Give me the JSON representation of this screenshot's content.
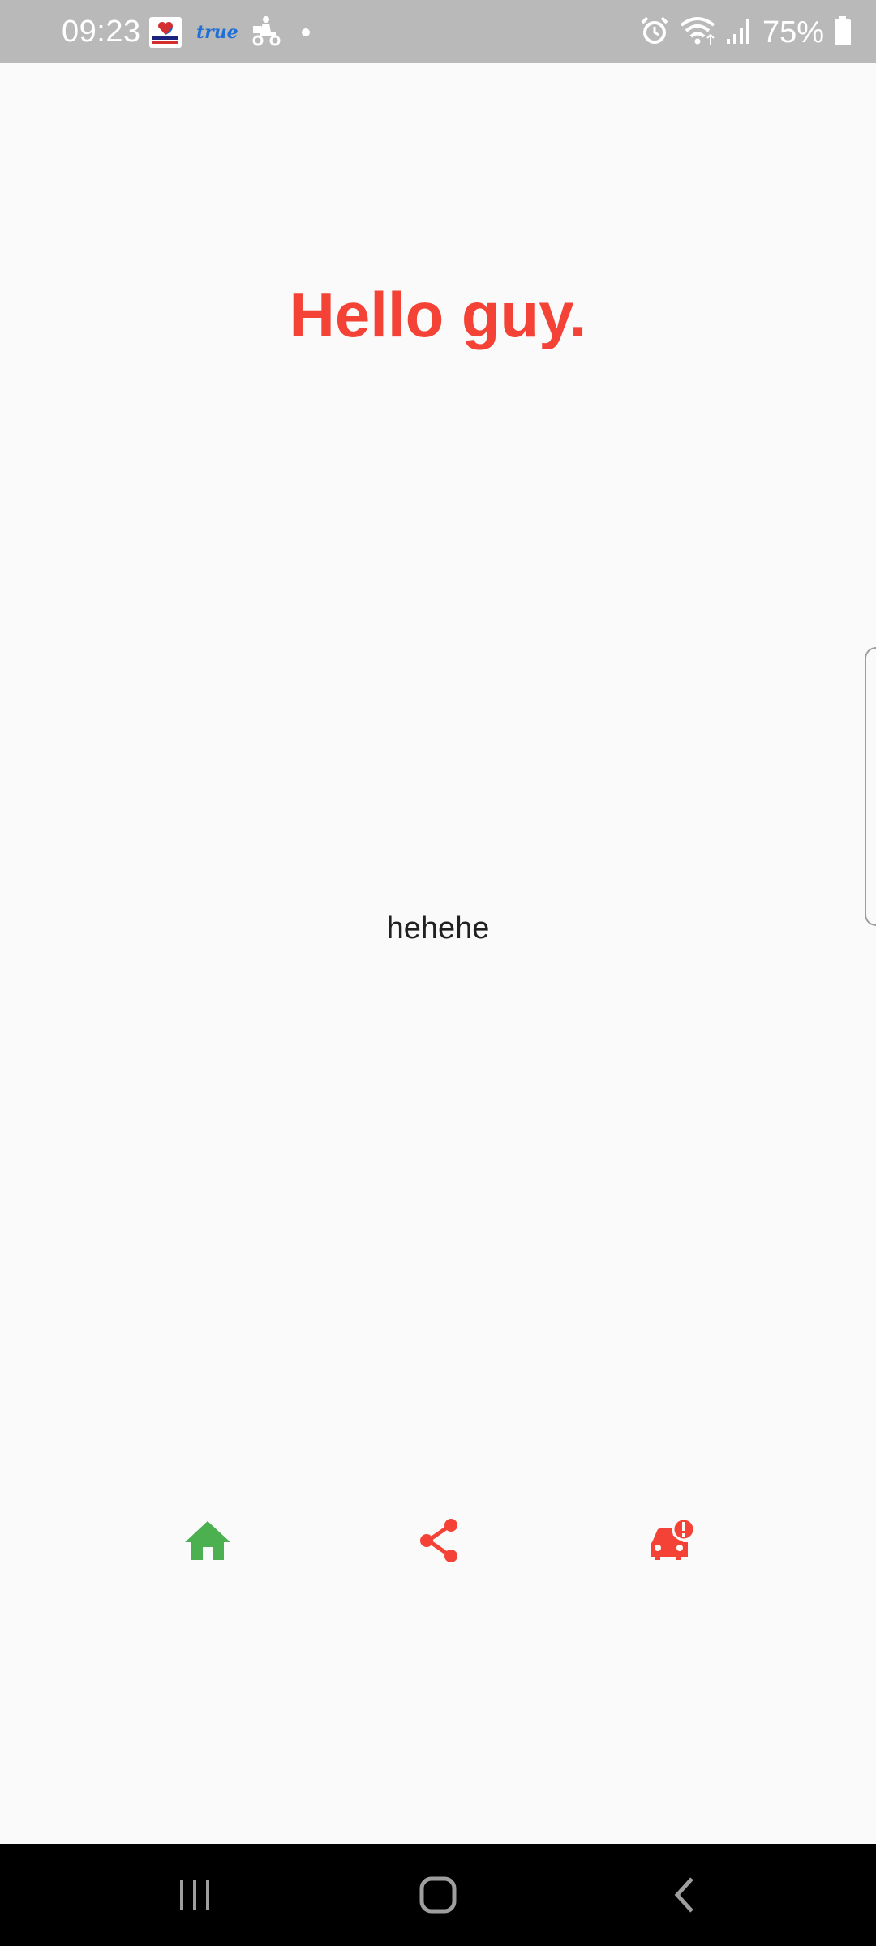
{
  "status_bar": {
    "time": "09:23",
    "battery": "75%",
    "notification_icons": [
      "vpn-badge-icon",
      "true-logo-icon",
      "scooter-delivery-icon",
      "dot-icon"
    ],
    "system_icons": [
      "alarm-icon",
      "wifi-icon",
      "cell-signal-icon",
      "battery-icon"
    ],
    "true_logo_text": "true"
  },
  "main": {
    "greeting": "Hello guy.",
    "body_text": "hehehe"
  },
  "bottom_actions": [
    {
      "icon": "home-icon",
      "color": "#4caf50"
    },
    {
      "icon": "share-icon",
      "color": "#f44336"
    },
    {
      "icon": "car-alert-icon",
      "color": "#f44336"
    }
  ],
  "nav_bar": {
    "buttons": [
      "recent-apps-icon",
      "home-nav-icon",
      "back-icon"
    ]
  },
  "colors": {
    "accent_red": "#f44336",
    "accent_green": "#4caf50",
    "status_bar_bg": "#b9b9b9",
    "background": "#fafafa"
  }
}
